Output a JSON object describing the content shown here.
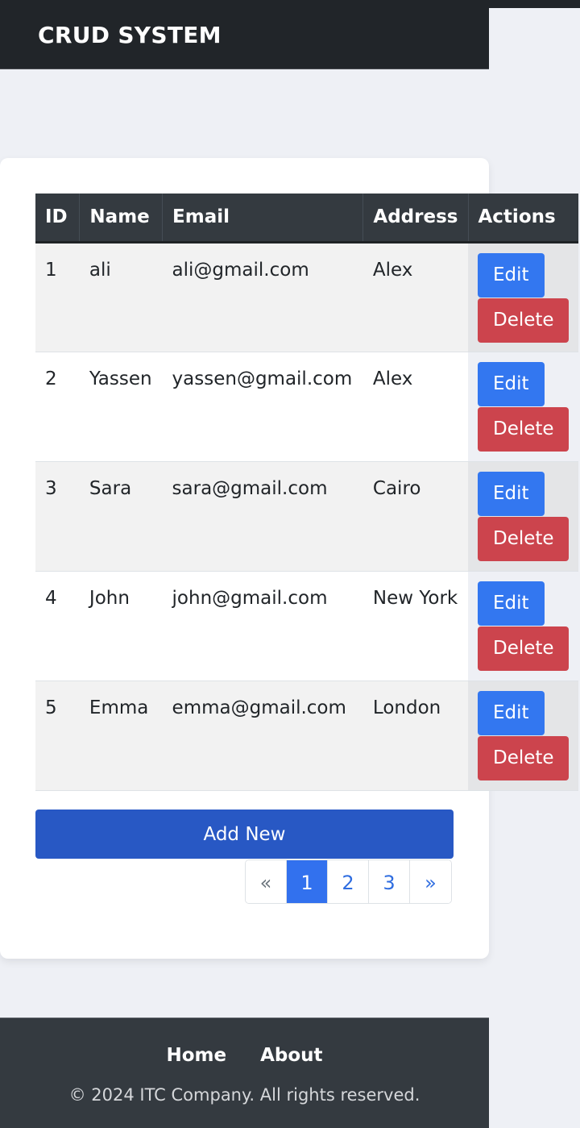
{
  "header": {
    "title": "CRUD SYSTEM"
  },
  "table": {
    "columns": [
      "ID",
      "Name",
      "Email",
      "Address",
      "Actions"
    ],
    "rows": [
      {
        "id": "1",
        "name": "ali",
        "email": "ali@gmail.com",
        "address": "Alex"
      },
      {
        "id": "2",
        "name": "Yassen",
        "email": "yassen@gmail.com",
        "address": "Alex"
      },
      {
        "id": "3",
        "name": "Sara",
        "email": "sara@gmail.com",
        "address": "Cairo"
      },
      {
        "id": "4",
        "name": "John",
        "email": "john@gmail.com",
        "address": "New York"
      },
      {
        "id": "5",
        "name": "Emma",
        "email": "emma@gmail.com",
        "address": "London"
      }
    ],
    "edit_label": "Edit",
    "delete_label": "Delete"
  },
  "actions": {
    "add_new_label": "Add New"
  },
  "pagination": {
    "prev": "«",
    "pages": [
      "1",
      "2",
      "3"
    ],
    "active_page": "1",
    "next": "»"
  },
  "footer": {
    "links": [
      "Home",
      "About"
    ],
    "copyright": "© 2024 ITC Company. All rights reserved."
  },
  "colors": {
    "header_bg": "#212529",
    "table_head_bg": "#343a40",
    "edit": "#3377f0",
    "delete": "#cc444d",
    "add_new": "#2858c4",
    "page_active": "#3271ee"
  }
}
